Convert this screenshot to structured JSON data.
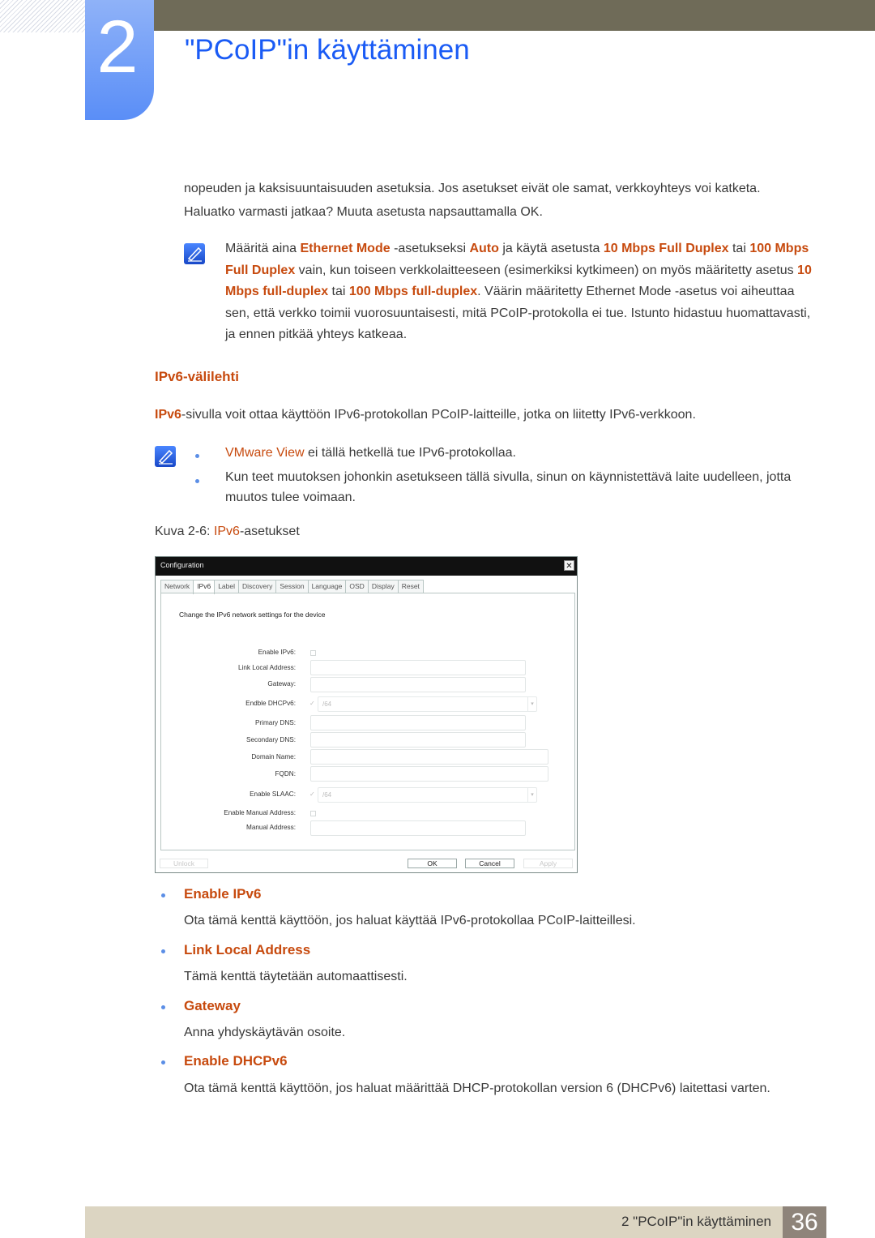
{
  "header": {
    "chapter_number": "2",
    "title": "\"PCoIP\"in käyttäminen"
  },
  "intro": {
    "line1": "nopeuden ja kaksisuuntaisuuden asetuksia. Jos asetukset eivät ole samat, verkkoyhteys voi katketa.",
    "line2": "Haluatko varmasti jatkaa? Muuta asetusta napsauttamalla OK."
  },
  "note1": {
    "icon": "note-pencil-icon",
    "parts": [
      {
        "t": "Määritä aina ",
        "hl": false
      },
      {
        "t": "Ethernet Mode",
        "hl": true
      },
      {
        "t": " -asetukseksi ",
        "hl": false
      },
      {
        "t": "Auto",
        "hl": true
      },
      {
        "t": " ja käytä asetusta ",
        "hl": false
      },
      {
        "t": "10 Mbps Full Duplex",
        "hl": true
      },
      {
        "t": " tai ",
        "hl": false
      },
      {
        "t": "100 Mbps Full Duplex",
        "hl": true
      },
      {
        "t": " vain, kun toiseen verkkolaitteeseen (esimerkiksi kytkimeen) on myös määritetty asetus ",
        "hl": false
      },
      {
        "t": "10 Mbps full-duplex",
        "hl": true
      },
      {
        "t": " tai ",
        "hl": false
      },
      {
        "t": "100 Mbps full-duplex",
        "hl": true
      },
      {
        "t": ". Väärin määritetty Ethernet Mode -asetus voi aiheuttaa sen, että verkko toimii vuorosuuntaisesti, mitä PCoIP-protokolla ei tue. Istunto hidastuu huomattavasti, ja ennen pitkää yhteys katkeaa.",
        "hl": false
      }
    ]
  },
  "section": {
    "title": "IPv6-välilehti",
    "intro_hl": "IPv6",
    "intro_rest": "-sivulla voit ottaa käyttöön IPv6-protokollan PCoIP-laitteille, jotka on liitetty IPv6-verkkoon."
  },
  "note2": {
    "icon": "note-pencil-icon",
    "bullet1_hl": "VMware View",
    "bullet1_rest": " ei tällä hetkellä tue IPv6-protokollaa.",
    "bullet2": "Kun teet muutoksen johonkin asetukseen tällä sivulla, sinun on käynnistettävä laite uudelleen, jotta muutos tulee voimaan."
  },
  "figure": {
    "prefix": "Kuva 2-6: ",
    "hl": "IPv6",
    "suffix": "-asetukset"
  },
  "dialog": {
    "title": "Configuration",
    "close": "✕",
    "tabs": [
      "Network",
      "IPv6",
      "Label",
      "Discovery",
      "Session",
      "Language",
      "OSD",
      "Display",
      "Reset"
    ],
    "active_tab": "IPv6",
    "heading": "Change the IPv6 network settings for the device",
    "fields": {
      "enable_ipv6": {
        "label": "Enable IPv6:",
        "checked": false
      },
      "link_local": {
        "label": "Link Local Address:",
        "value": ""
      },
      "gateway": {
        "label": "Gateway:",
        "value": ""
      },
      "dhcpv6": {
        "label": "Endble DHCPv6:",
        "checked": true,
        "select_value": "/64"
      },
      "primary_dns": {
        "label": "Primary DNS:",
        "value": ""
      },
      "secondary_dns": {
        "label": "Secondary DNS:",
        "value": ""
      },
      "domain_name": {
        "label": "Domain Name:",
        "value": ""
      },
      "fqdn": {
        "label": "FQDN:",
        "value": ""
      },
      "slaac": {
        "label": "Enable SLAAC:",
        "checked": true,
        "select_value": "/64"
      },
      "enable_manual": {
        "label": "Enable Manual Address:",
        "checked": false
      },
      "manual_address": {
        "label": "Manual Address:",
        "value": ""
      }
    },
    "buttons": {
      "unlock": "Unlock",
      "ok": "OK",
      "cancel": "Cancel",
      "apply": "Apply"
    }
  },
  "items": [
    {
      "title": "Enable IPv6",
      "desc": "Ota tämä kenttä käyttöön, jos haluat käyttää IPv6-protokollaa PCoIP-laitteillesi."
    },
    {
      "title": "Link Local Address",
      "desc": "Tämä kenttä täytetään automaattisesti."
    },
    {
      "title": "Gateway",
      "desc": "Anna yhdyskäytävän osoite."
    },
    {
      "title": "Enable DHCPv6",
      "desc": "Ota tämä kenttä käyttöön, jos haluat määrittää DHCP-protokollan version 6 (DHCPv6) laitettasi varten."
    }
  ],
  "footer": {
    "label": "2 \"PCoIP\"in käyttäminen",
    "page": "36"
  },
  "colors": {
    "accent_orange": "#c74a0e",
    "title_blue": "#1a5bf5",
    "topbar": "#6f6b58",
    "footer_bg": "#dcd5c2"
  }
}
